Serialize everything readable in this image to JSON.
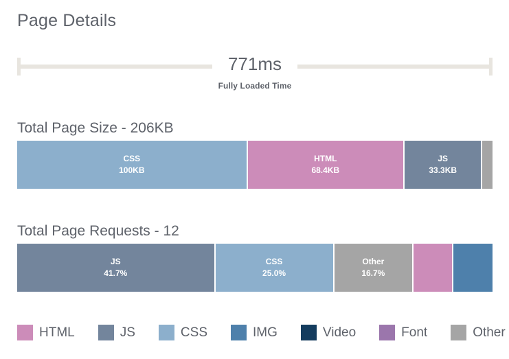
{
  "page_title": "Page Details",
  "load_time": {
    "value": "771ms",
    "caption": "Fully Loaded Time"
  },
  "size_section": {
    "heading": "Total Page Size - 206KB"
  },
  "requests_section": {
    "heading": "Total Page Requests - 12"
  },
  "colors": {
    "HTML": "#cc8cb9",
    "JS": "#73859c",
    "CSS": "#8cafcc",
    "IMG": "#4e80ab",
    "Video": "#143c5e",
    "Font": "#9b76ac",
    "Other": "#a5a5a5",
    "rail": "#e8e5df",
    "text": "#5e626a"
  },
  "legend": [
    {
      "label": "HTML",
      "color_key": "HTML"
    },
    {
      "label": "JS",
      "color_key": "JS"
    },
    {
      "label": "CSS",
      "color_key": "CSS"
    },
    {
      "label": "IMG",
      "color_key": "IMG"
    },
    {
      "label": "Video",
      "color_key": "Video"
    },
    {
      "label": "Font",
      "color_key": "Font"
    },
    {
      "label": "Other",
      "color_key": "Other"
    }
  ],
  "chart_data": [
    {
      "type": "bar",
      "subtype": "stacked-horizontal-100",
      "title": "Total Page Size - 206KB",
      "total": "206KB",
      "total_value": 206,
      "unit": "KB",
      "xlabel": "",
      "ylabel": "",
      "legend_position": "bottom",
      "grid": false,
      "categories": [
        "CSS",
        "HTML",
        "JS",
        "Other"
      ],
      "values": [
        100,
        68.4,
        33.3,
        4.3
      ],
      "segments": [
        {
          "label": "CSS",
          "value": "100KB",
          "number": 100,
          "percent": 48.5,
          "color_key": "CSS",
          "show_text": true
        },
        {
          "label": "HTML",
          "value": "68.4KB",
          "number": 68.4,
          "percent": 33.0,
          "color_key": "HTML",
          "show_text": true
        },
        {
          "label": "JS",
          "value": "33.3KB",
          "number": 33.3,
          "percent": 16.4,
          "color_key": "JS",
          "show_text": true
        },
        {
          "label": "Other",
          "value": "",
          "number": 4.3,
          "percent": 2.1,
          "color_key": "Other",
          "show_text": false
        }
      ]
    },
    {
      "type": "bar",
      "subtype": "stacked-horizontal-100",
      "title": "Total Page Requests - 12",
      "total": "12",
      "total_value": 12,
      "unit": "requests",
      "xlabel": "",
      "ylabel": "",
      "legend_position": "bottom",
      "grid": false,
      "categories": [
        "JS",
        "CSS",
        "Other",
        "HTML",
        "IMG"
      ],
      "values": [
        41.7,
        25.0,
        16.7,
        8.3,
        8.3
      ],
      "segments": [
        {
          "label": "JS",
          "value": "41.7%",
          "number": 41.7,
          "percent": 41.7,
          "color_key": "JS",
          "show_text": true
        },
        {
          "label": "CSS",
          "value": "25.0%",
          "number": 25.0,
          "percent": 25.0,
          "color_key": "CSS",
          "show_text": true
        },
        {
          "label": "Other",
          "value": "16.7%",
          "number": 16.7,
          "percent": 16.7,
          "color_key": "Other",
          "show_text": true
        },
        {
          "label": "HTML",
          "value": "",
          "number": 8.3,
          "percent": 8.3,
          "color_key": "HTML",
          "show_text": false
        },
        {
          "label": "IMG",
          "value": "",
          "number": 8.3,
          "percent": 8.3,
          "color_key": "IMG",
          "show_text": false
        }
      ]
    }
  ]
}
